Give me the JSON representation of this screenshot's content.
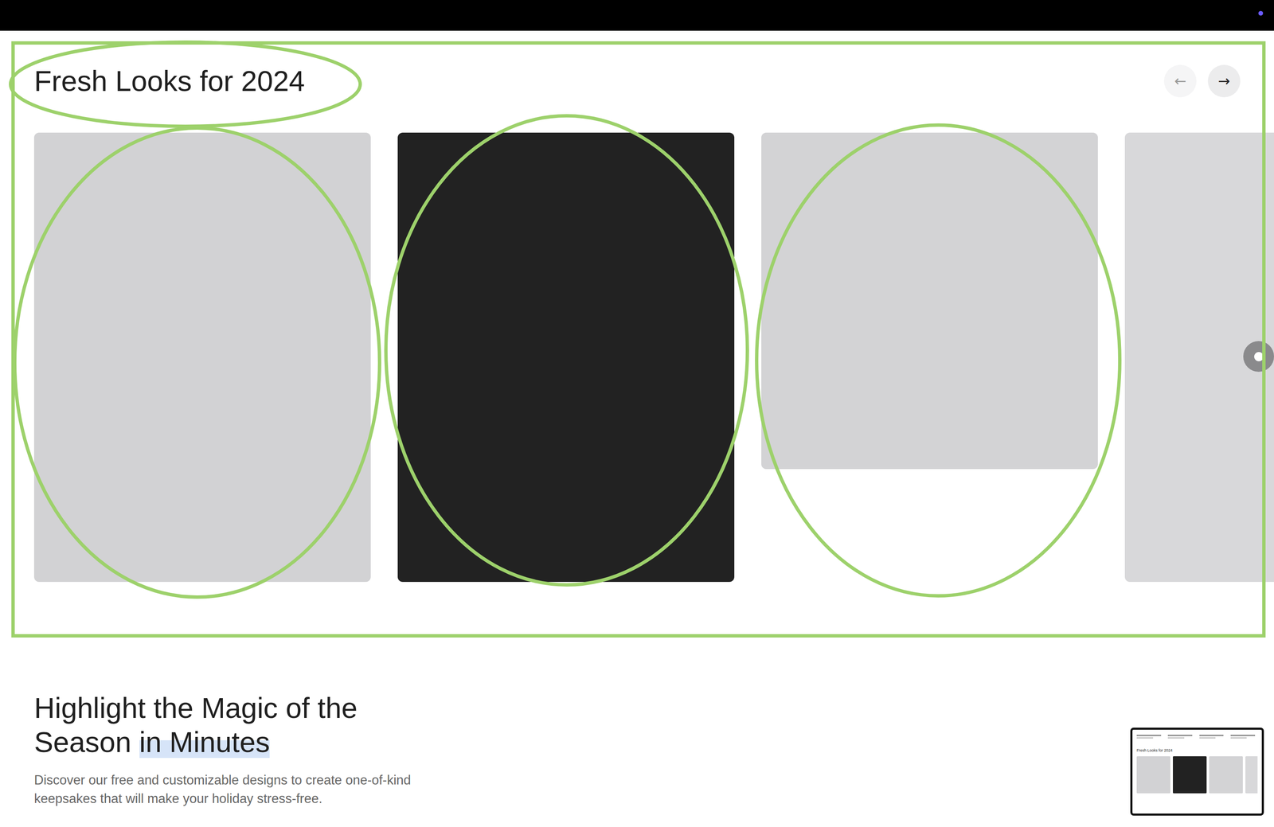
{
  "section": {
    "title": "Fresh Looks for 2024",
    "prev_button": {
      "label": "←",
      "disabled": true
    },
    "next_button": {
      "label": "→",
      "disabled": false
    }
  },
  "cards": [
    {
      "kind": "tall",
      "color": "#d2d2d4"
    },
    {
      "kind": "tall",
      "color": "#222222"
    },
    {
      "kind": "square",
      "color": "#d3d3d5"
    },
    {
      "kind": "partial",
      "color": "#d8d8da"
    }
  ],
  "heading": {
    "text": "Highlight the Magic of the Season",
    "highlight": "in Minutes"
  },
  "description": "Discover our free and customizable designs to create one-of-kind keepsakes that will make your holiday stress-free.",
  "preview": {
    "title": "Fresh Looks for 2024"
  }
}
